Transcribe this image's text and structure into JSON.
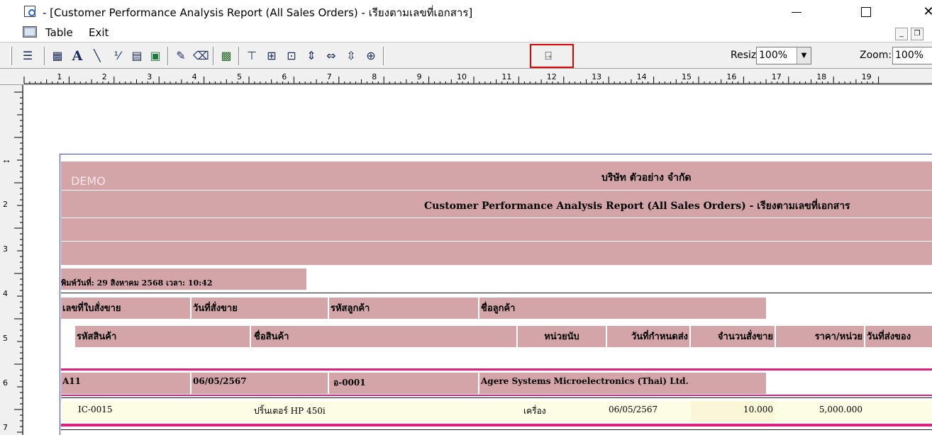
{
  "window": {
    "title": "- [Customer Performance Analysis Report (All Sales Orders) - เรียงตามเลขที่เอกสาร]"
  },
  "menu": {
    "items": [
      "Table",
      "Exit"
    ]
  },
  "toolbar": {
    "resize_label": "Resize:",
    "resize_value": "100%",
    "zoom_label": "Zoom:",
    "zoom_value": "100%",
    "buttons": [
      "align-icon",
      "grid-icon",
      "text-icon",
      "line-icon",
      "formula-icon",
      "field-icon",
      "image-icon",
      "chart-icon",
      "eraser-icon",
      "properties-icon",
      "align-top-icon",
      "align-bottom-icon",
      "group-icon",
      "space-icon",
      "width-icon",
      "height-icon",
      "size-icon",
      "exit-door-icon"
    ],
    "highlight_color": "#e00000"
  },
  "ruler": {
    "numbers": [
      "1",
      "2",
      "3",
      "4",
      "5",
      "6",
      "7",
      "8",
      "9",
      "10",
      "11",
      "12",
      "13",
      "14",
      "15",
      "16",
      "17",
      "18",
      "19"
    ],
    "vnumbers": [
      "2",
      "3",
      "4",
      "5",
      "6",
      "7"
    ]
  },
  "report": {
    "watermark": "DEMO",
    "company": "บริษัท ตัวอย่าง จำกัด",
    "report_title": "Customer Performance Analysis Report (All Sales Orders) - เรียงตามเลขที่เอกสาร",
    "print_info": "พิมพ์วันที่: 29 สิงหาคม 2568 เวลา: 10:42",
    "header_row1": {
      "doc_no": "เลขที่ใบสั่งขาย",
      "doc_date": "วันที่สั่งขาย",
      "cust_code": "รหัสลูกค้า",
      "cust_name": "ชื่อลูกค้า"
    },
    "header_row2": {
      "item_code": "รหัสสินค้า",
      "item_name": "ชื่อสินค้า",
      "unit": "หน่วยนับ",
      "due_date": "วันที่กำหนดส่ง",
      "qty": "จำนวนสั่งขาย",
      "price": "ราคา/หน่วย",
      "ship_date": "วันที่ส่งของ"
    },
    "order": {
      "doc_no": "A11",
      "doc_date": "06/05/2567",
      "cust_code": "อ-0001",
      "cust_name": "Agere Systems Microelectronics (Thai) Ltd."
    },
    "item": {
      "item_code": "IC-0015",
      "item_name": "ปริ้นเตอร์ HP 450i",
      "unit": "เครื่อง",
      "due_date": "06/05/2567",
      "qty": "10.000",
      "price": "5,000.000"
    },
    "band_color": "#d4a5a8",
    "accent_color": "#e0207e"
  }
}
